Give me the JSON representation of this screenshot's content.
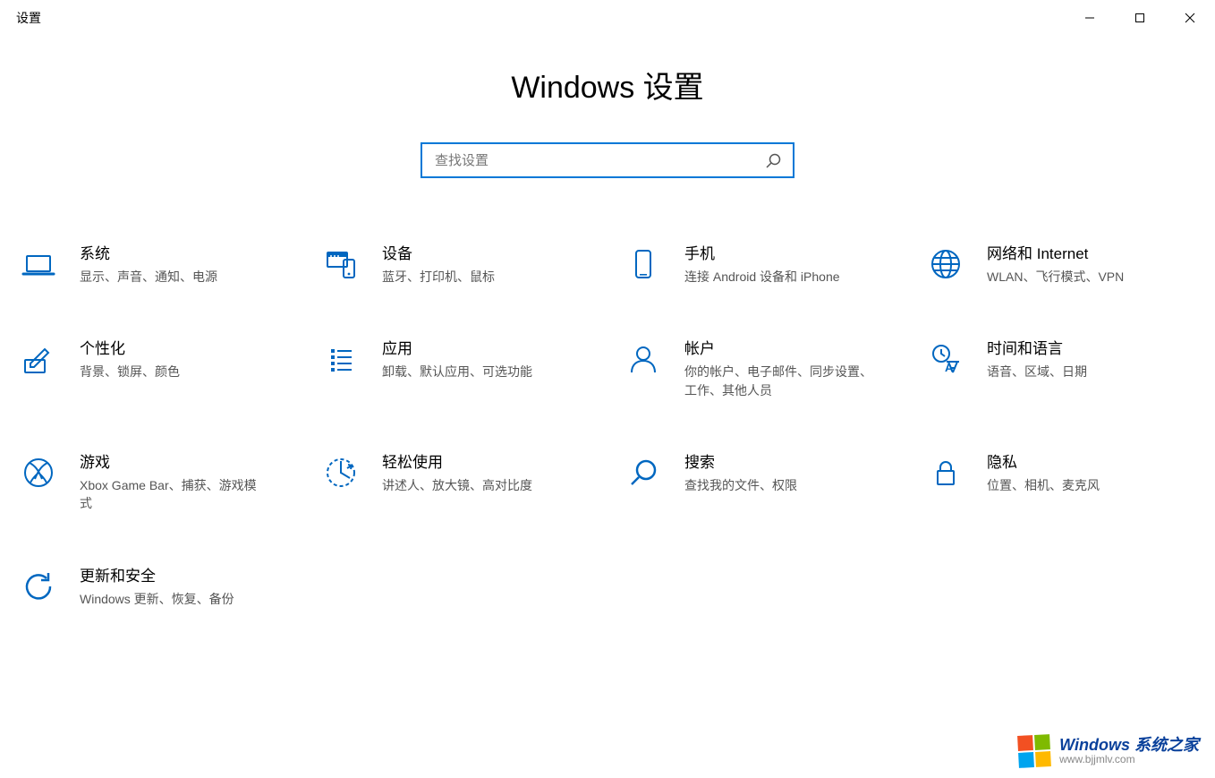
{
  "window": {
    "title": "设置"
  },
  "page": {
    "heading": "Windows 设置"
  },
  "search": {
    "placeholder": "查找设置",
    "value": ""
  },
  "categories": [
    {
      "id": "system",
      "icon": "laptop",
      "title": "系统",
      "desc": "显示、声音、通知、电源"
    },
    {
      "id": "devices",
      "icon": "devices",
      "title": "设备",
      "desc": "蓝牙、打印机、鼠标"
    },
    {
      "id": "phone",
      "icon": "phone",
      "title": "手机",
      "desc": "连接 Android 设备和 iPhone"
    },
    {
      "id": "network",
      "icon": "globe",
      "title": "网络和 Internet",
      "desc": "WLAN、飞行模式、VPN"
    },
    {
      "id": "personalize",
      "icon": "pen",
      "title": "个性化",
      "desc": "背景、锁屏、颜色"
    },
    {
      "id": "apps",
      "icon": "list",
      "title": "应用",
      "desc": "卸载、默认应用、可选功能"
    },
    {
      "id": "accounts",
      "icon": "person",
      "title": "帐户",
      "desc": "你的帐户、电子邮件、同步设置、工作、其他人员"
    },
    {
      "id": "time-lang",
      "icon": "time-lang",
      "title": "时间和语言",
      "desc": "语音、区域、日期"
    },
    {
      "id": "gaming",
      "icon": "xbox",
      "title": "游戏",
      "desc": "Xbox Game Bar、捕获、游戏模式"
    },
    {
      "id": "ease",
      "icon": "ease",
      "title": "轻松使用",
      "desc": "讲述人、放大镜、高对比度"
    },
    {
      "id": "search-cat",
      "icon": "search",
      "title": "搜索",
      "desc": "查找我的文件、权限"
    },
    {
      "id": "privacy",
      "icon": "lock",
      "title": "隐私",
      "desc": "位置、相机、麦克风"
    },
    {
      "id": "update",
      "icon": "update",
      "title": "更新和安全",
      "desc": "Windows 更新、恢复、备份"
    }
  ],
  "watermark": {
    "brand_prefix": "Windows",
    "brand_suffix": "系统之家",
    "url": "www.bjjmlv.com"
  },
  "colors": {
    "accent": "#0078d7",
    "icon": "#0067c0",
    "text_secondary": "#555"
  }
}
